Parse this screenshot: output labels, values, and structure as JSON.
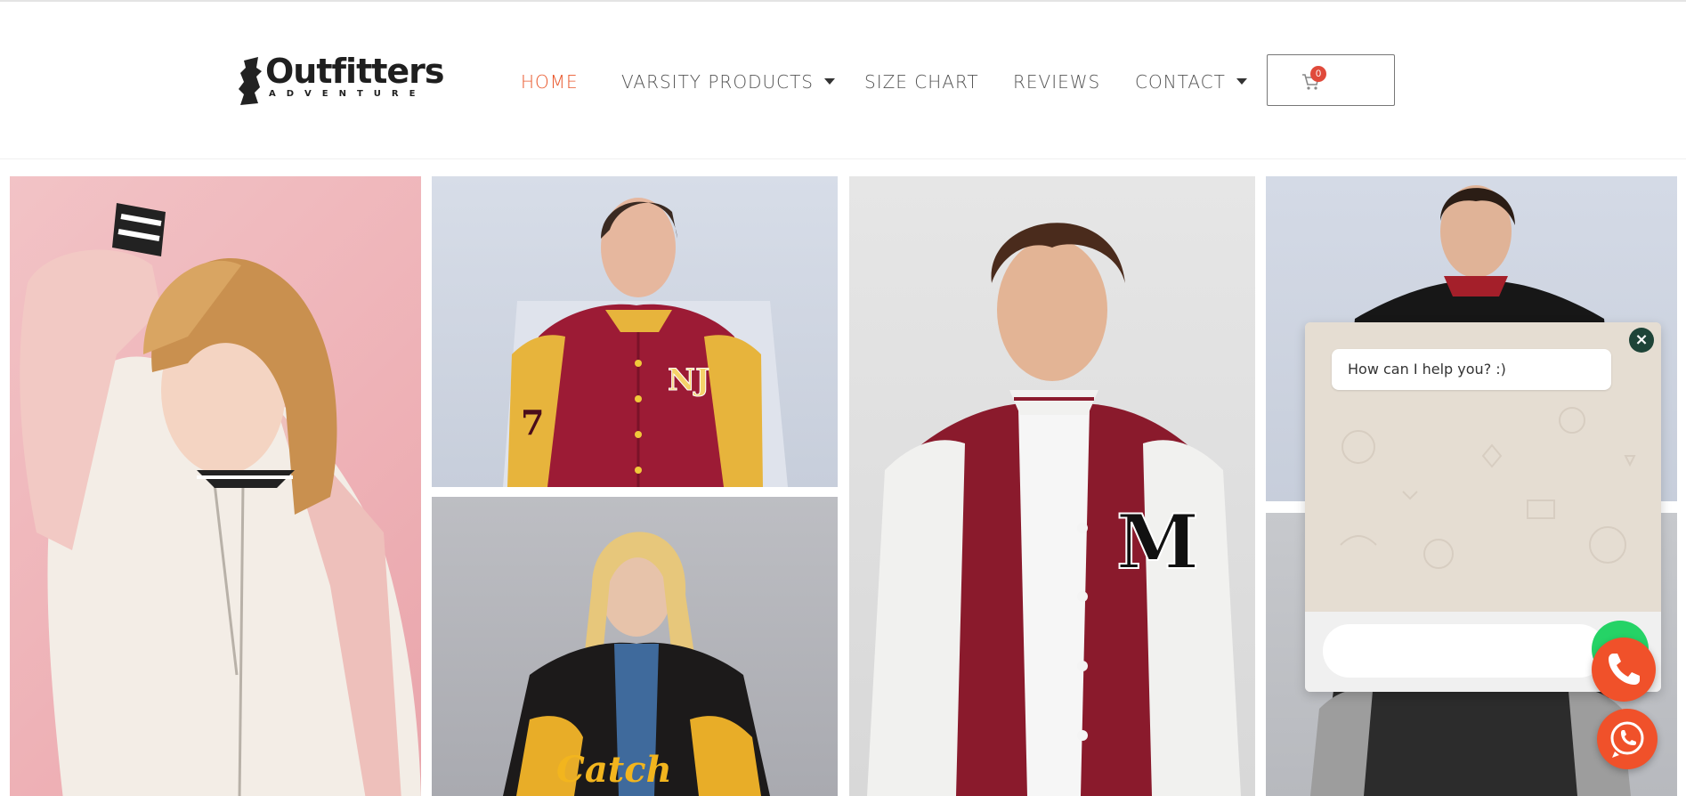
{
  "brand": {
    "name": "Outfitters",
    "tagline": "ADVENTURE"
  },
  "nav": {
    "items": [
      {
        "label": "HOME",
        "active": true,
        "dropdown": false
      },
      {
        "label": "VARSITY PRODUCTS",
        "active": false,
        "dropdown": true
      },
      {
        "label": "SIZE CHART",
        "active": false,
        "dropdown": false
      },
      {
        "label": "REVIEWS",
        "active": false,
        "dropdown": false
      },
      {
        "label": "CONTACT",
        "active": false,
        "dropdown": true
      }
    ],
    "active_color": "#e9572b"
  },
  "cart": {
    "count": "0",
    "icon": "cart-icon"
  },
  "gallery": {
    "photos": [
      {
        "subject": "woman-pink-bomber"
      },
      {
        "subject": "woman-maroon-varsity"
      },
      {
        "subject": "woman-black-yellow-varsity"
      },
      {
        "subject": "man-maroon-varsity"
      },
      {
        "subject": "man-black-varsity"
      },
      {
        "subject": "jacket-grey-leather"
      }
    ]
  },
  "chat": {
    "greeting": "How can I help you? :)",
    "input_placeholder": "",
    "close_icon": "close-icon",
    "send_icon": "whatsapp-send-icon"
  },
  "floating_buttons": {
    "phone_icon": "phone-icon",
    "whatsapp_icon": "whatsapp-icon",
    "color": "#f0512a"
  }
}
